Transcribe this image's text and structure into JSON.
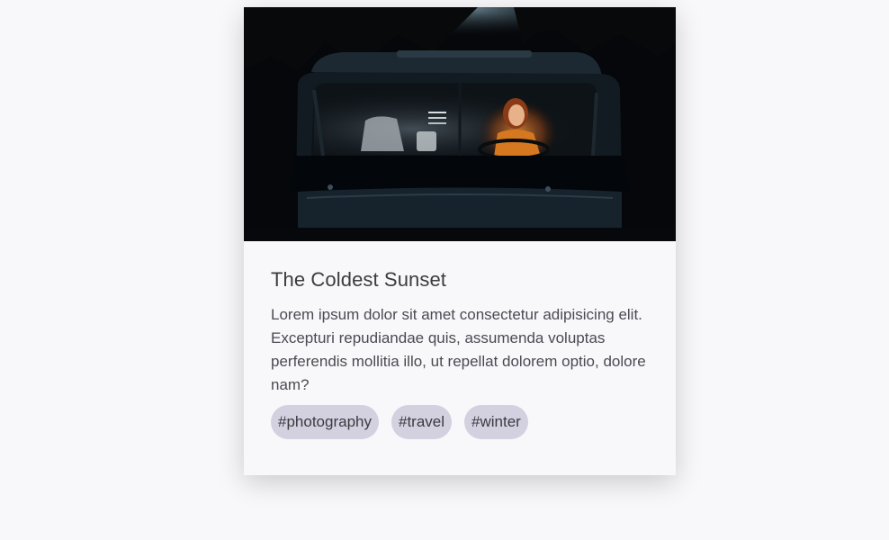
{
  "card": {
    "image_alt": "Person in a car at night",
    "title": "The Coldest Sunset",
    "description": "Lorem ipsum dolor sit amet consectetur adipisicing elit. Excepturi repudiandae quis, assumenda voluptas perferendis mollitia illo, ut repellat dolorem optio, dolore nam?",
    "tags": [
      {
        "label": "#photography"
      },
      {
        "label": "#travel"
      },
      {
        "label": "#winter"
      }
    ]
  },
  "colors": {
    "background": "#f8f8fb",
    "tag_background": "#d3d0e0",
    "title": "#3b3b40",
    "text": "#4a4a52"
  }
}
